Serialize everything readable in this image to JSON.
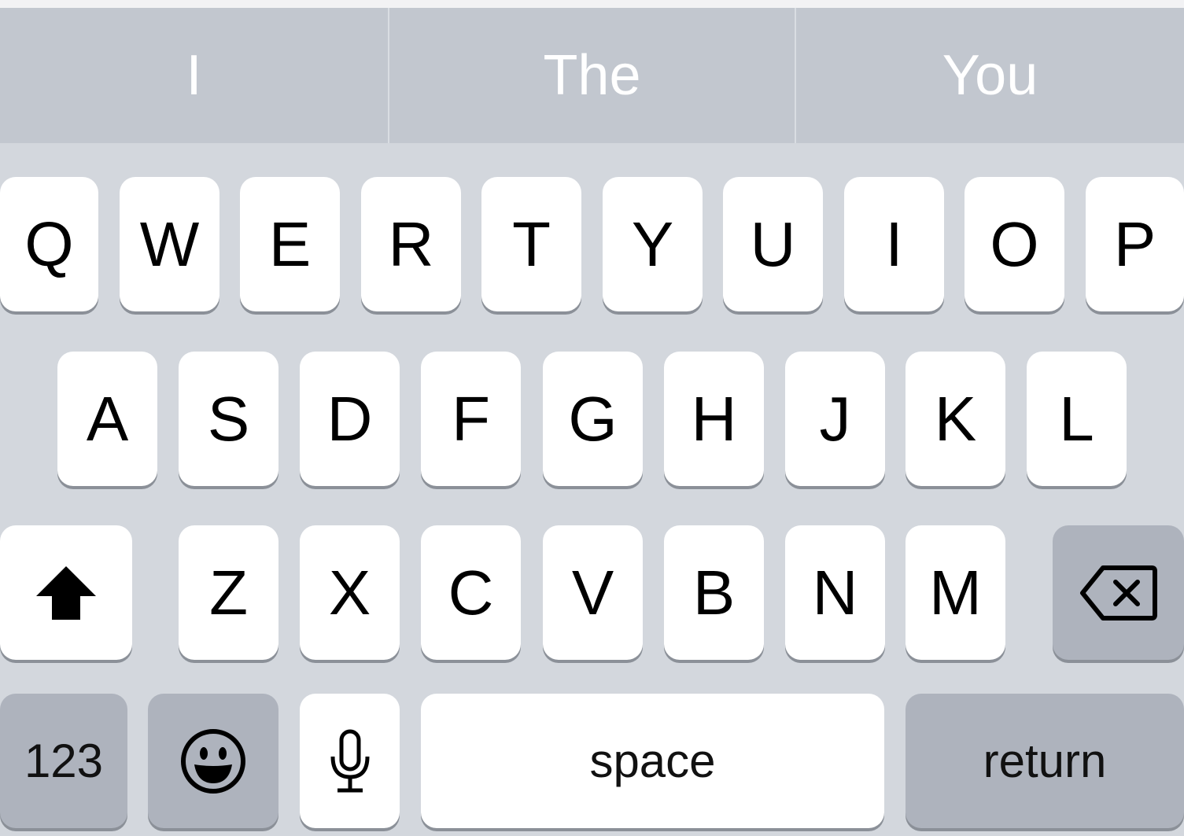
{
  "suggestions": [
    "I",
    "The",
    "You"
  ],
  "rows": [
    [
      "Q",
      "W",
      "E",
      "R",
      "T",
      "Y",
      "U",
      "I",
      "O",
      "P"
    ],
    [
      "A",
      "S",
      "D",
      "F",
      "G",
      "H",
      "J",
      "K",
      "L"
    ],
    [
      "Z",
      "X",
      "C",
      "V",
      "B",
      "N",
      "M"
    ]
  ],
  "bottom": {
    "numbers_label": "123",
    "space_label": "space",
    "return_label": "return"
  },
  "icons": {
    "shift": "shift-arrow-icon",
    "delete": "backspace-icon",
    "emoji": "smiley-face-icon",
    "mic": "microphone-icon"
  },
  "colors": {
    "keyboard_bg": "#d3d7dd",
    "suggestion_bar_bg": "#c2c7cf",
    "key_bg": "#ffffff",
    "special_key_bg": "#aeb3bd"
  }
}
